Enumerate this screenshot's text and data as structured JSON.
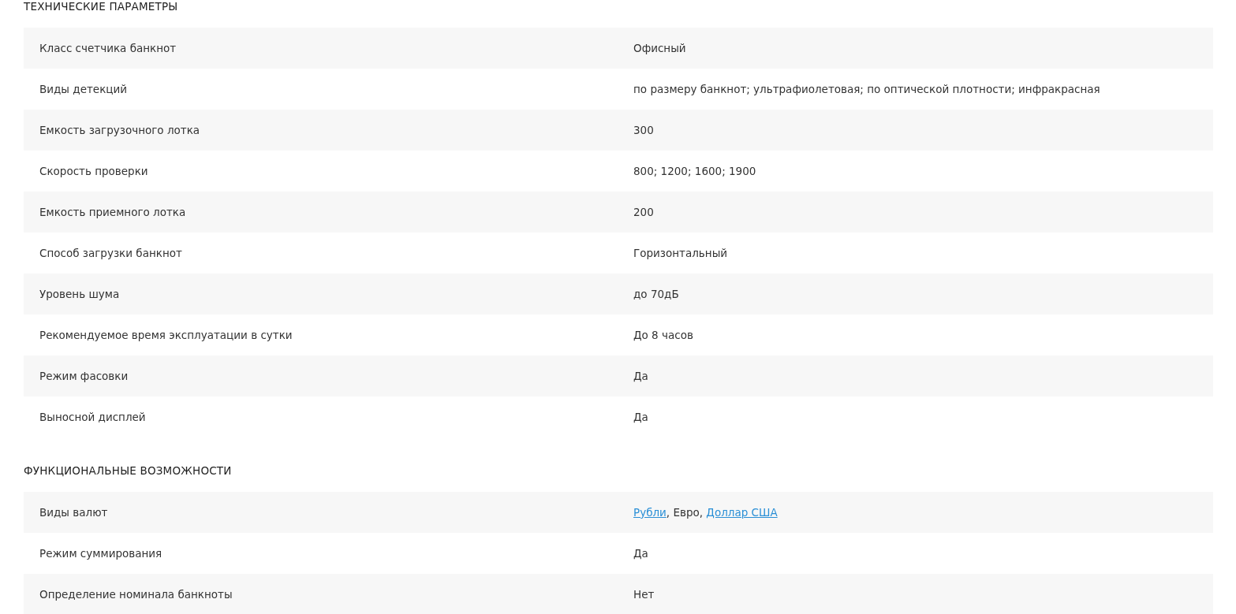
{
  "sections": [
    {
      "title": "ТЕХНИЧЕСКИЕ ПАРАМЕТРЫ",
      "rows": [
        {
          "label": "Класс счетчика банкнот",
          "value": [
            {
              "kind": "text",
              "text": "Офисный"
            }
          ]
        },
        {
          "label": "Виды детекций",
          "value": [
            {
              "kind": "text",
              "text": "по размеру банкнот; ультрафиолетовая; по оптической плотности; инфракрасная"
            }
          ]
        },
        {
          "label": "Емкость загрузочного лотка",
          "value": [
            {
              "kind": "text",
              "text": "300"
            }
          ]
        },
        {
          "label": "Скорость проверки",
          "value": [
            {
              "kind": "text",
              "text": "800; 1200; 1600; 1900"
            }
          ]
        },
        {
          "label": "Емкость приемного лотка",
          "value": [
            {
              "kind": "text",
              "text": "200"
            }
          ]
        },
        {
          "label": "Способ загрузки банкнот",
          "value": [
            {
              "kind": "text",
              "text": "Горизонтальный"
            }
          ]
        },
        {
          "label": "Уровень шума",
          "value": [
            {
              "kind": "text",
              "text": "до 70дБ"
            }
          ]
        },
        {
          "label": "Рекомендуемое время эксплуатации в сутки",
          "value": [
            {
              "kind": "text",
              "text": "До 8 часов"
            }
          ]
        },
        {
          "label": "Режим фасовки",
          "value": [
            {
              "kind": "text",
              "text": "Да"
            }
          ]
        },
        {
          "label": "Выносной дисплей",
          "value": [
            {
              "kind": "text",
              "text": "Да"
            }
          ]
        }
      ]
    },
    {
      "title": "ФУНКЦИОНАЛЬНЫЕ ВОЗМОЖНОСТИ",
      "rows": [
        {
          "label": "Виды валют",
          "value": [
            {
              "kind": "link",
              "text": "Рубли"
            },
            {
              "kind": "text",
              "text": ", Евро, "
            },
            {
              "kind": "link",
              "text": "Доллар США"
            }
          ]
        },
        {
          "label": "Режим суммирования",
          "value": [
            {
              "kind": "text",
              "text": "Да"
            }
          ]
        },
        {
          "label": "Определение номинала банкноты",
          "value": [
            {
              "kind": "text",
              "text": "Нет"
            }
          ]
        }
      ]
    }
  ]
}
